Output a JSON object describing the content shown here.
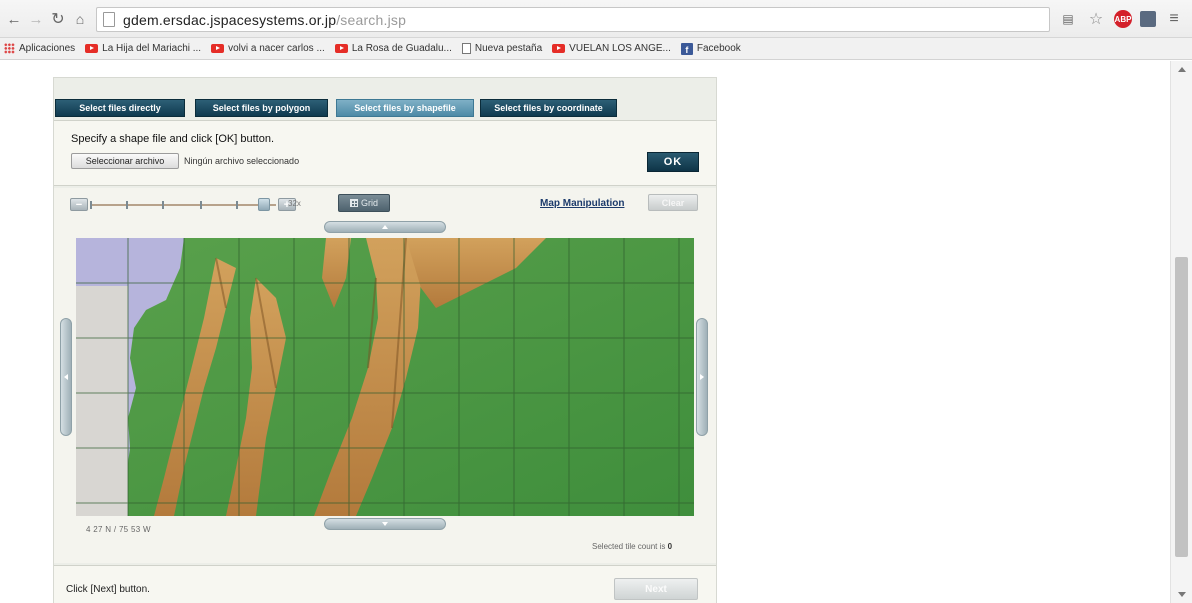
{
  "browser": {
    "url_host": "gdem.ersdac.jspacesystems.or.jp",
    "url_path": "/search.jsp",
    "bookmarks": [
      {
        "label": "Aplicaciones",
        "icon": "apps-icon"
      },
      {
        "label": "La Hija del Mariachi ...",
        "icon": "youtube-icon"
      },
      {
        "label": "volvi a nacer carlos ...",
        "icon": "youtube-icon"
      },
      {
        "label": "La Rosa de Guadalu...",
        "icon": "youtube-icon"
      },
      {
        "label": "Nueva pestaña",
        "icon": "page-icon"
      },
      {
        "label": "VUELAN LOS ANGE...",
        "icon": "youtube-icon"
      },
      {
        "label": "Facebook",
        "icon": "facebook-icon"
      }
    ]
  },
  "tabs": [
    {
      "label": "Select files directly",
      "active": false
    },
    {
      "label": "Select files by polygon",
      "active": false
    },
    {
      "label": "Select files by shapefile",
      "active": true
    },
    {
      "label": "Select files by coordinate",
      "active": false
    }
  ],
  "shape": {
    "instruction": "Specify a shape file and click [OK] button.",
    "file_button": "Seleccionar archivo",
    "file_status": "Ningún archivo seleccionado",
    "ok": "OK"
  },
  "map": {
    "zoom_label": "32x",
    "grid_button": "Grid",
    "manipulation_link": "Map Manipulation",
    "clear_button": "Clear",
    "coordinates": "4 27 N / 75 53 W",
    "tile_count_label": "Selected tile count is",
    "tile_count": "0"
  },
  "footer": {
    "instruction": "Click [Next] button.",
    "next": "Next"
  },
  "colors": {
    "tab_dark": "#0f3a4f",
    "tab_active": "#4d8aa6",
    "sea": "#b6b4dc",
    "lowland": "#4d9a45",
    "highland": "#c8924a"
  }
}
